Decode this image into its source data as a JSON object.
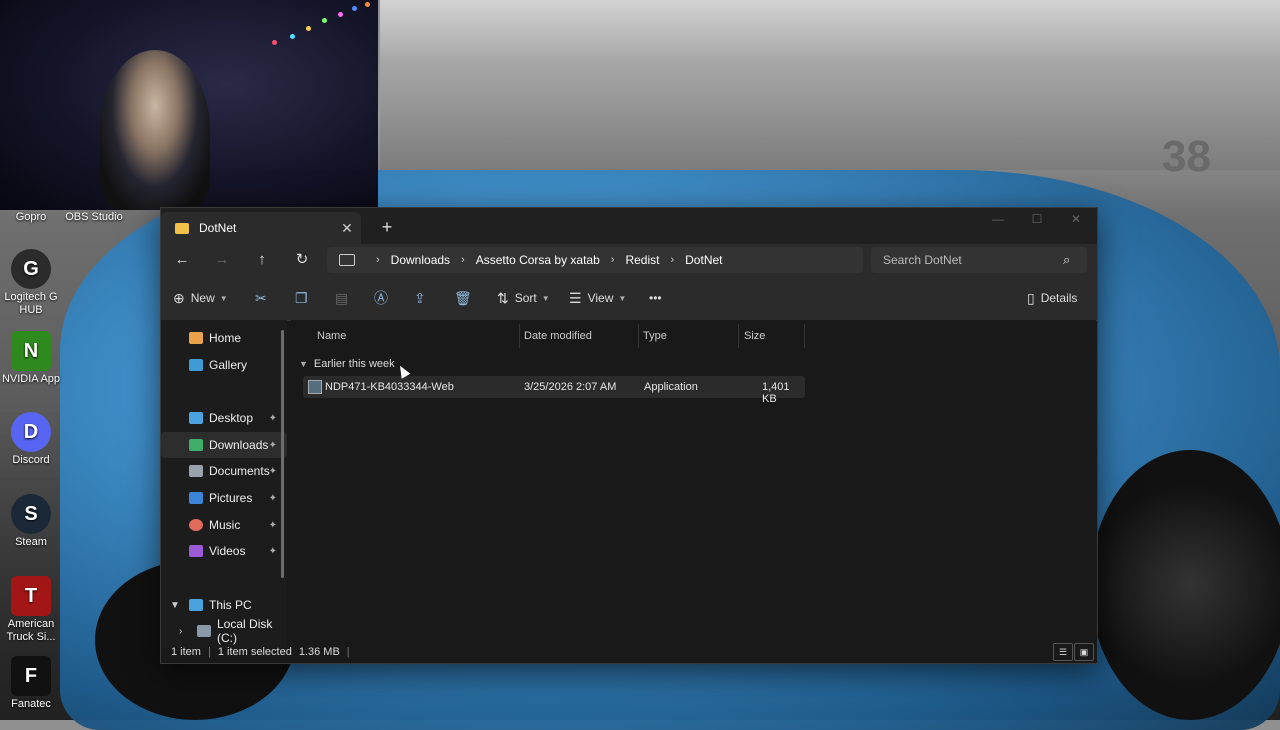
{
  "desktop": {
    "top_labels": [
      "Gopro",
      "OBS Studio"
    ],
    "icons": [
      {
        "label": "Logitech G HUB",
        "glyph": "G",
        "color": "#2b2b2b"
      },
      {
        "label": "NVIDIA App",
        "glyph": "N",
        "color": "#2f8a1e"
      },
      {
        "label": "Discord",
        "glyph": "D",
        "color": "#5865f2"
      },
      {
        "label": "Steam",
        "glyph": "S",
        "color": "#1b2838"
      },
      {
        "label": "American Truck Si...",
        "glyph": "T",
        "color": "#a31616"
      },
      {
        "label": "Fanatec",
        "glyph": "F",
        "color": "#111111"
      }
    ]
  },
  "wallpaper": {
    "number": "38"
  },
  "window": {
    "tab_title": "DotNet",
    "tab_close": "✕",
    "new_tab": "+",
    "controls": {
      "minimize": "—",
      "maximize": "☐",
      "close": "✕"
    }
  },
  "address": {
    "crumbs": [
      "Downloads",
      "Assetto Corsa by xatab",
      "Redist",
      "DotNet"
    ],
    "separator": "›",
    "search_placeholder": "Search DotNet"
  },
  "toolbar": {
    "new_label": "New",
    "sort_label": "Sort",
    "view_label": "View",
    "more_label": "•••",
    "details_label": "Details"
  },
  "sidebar": {
    "items": [
      {
        "label": "Home",
        "color": "#e9a14b",
        "pinned": false
      },
      {
        "label": "Gallery",
        "color": "#3f9bd6",
        "pinned": false
      },
      {
        "label": "Desktop",
        "color": "#4aa3df",
        "pinned": true
      },
      {
        "label": "Downloads",
        "color": "#3fae6b",
        "pinned": true
      },
      {
        "label": "Documents",
        "color": "#9aa3ad",
        "pinned": true
      },
      {
        "label": "Pictures",
        "color": "#3b84d6",
        "pinned": true
      },
      {
        "label": "Music",
        "color": "#e06b5a",
        "pinned": true
      },
      {
        "label": "Videos",
        "color": "#9b5bd6",
        "pinned": true
      },
      {
        "label": "This PC",
        "color": "#4aa3df",
        "pinned": false
      },
      {
        "label": "Local Disk (C:)",
        "color": "#8a9aa8",
        "pinned": false
      }
    ],
    "pin_glyph": "📌"
  },
  "columns": [
    "Name",
    "Date modified",
    "Type",
    "Size"
  ],
  "group_label": "Earlier this week",
  "files": [
    {
      "name": "NDP471-KB4033344-Web",
      "date": "3/25/2026 2:07 AM",
      "type": "Application",
      "size": "1,401 KB"
    }
  ],
  "status": {
    "count": "1 item",
    "selected": "1 item selected",
    "size": "1.36 MB"
  }
}
